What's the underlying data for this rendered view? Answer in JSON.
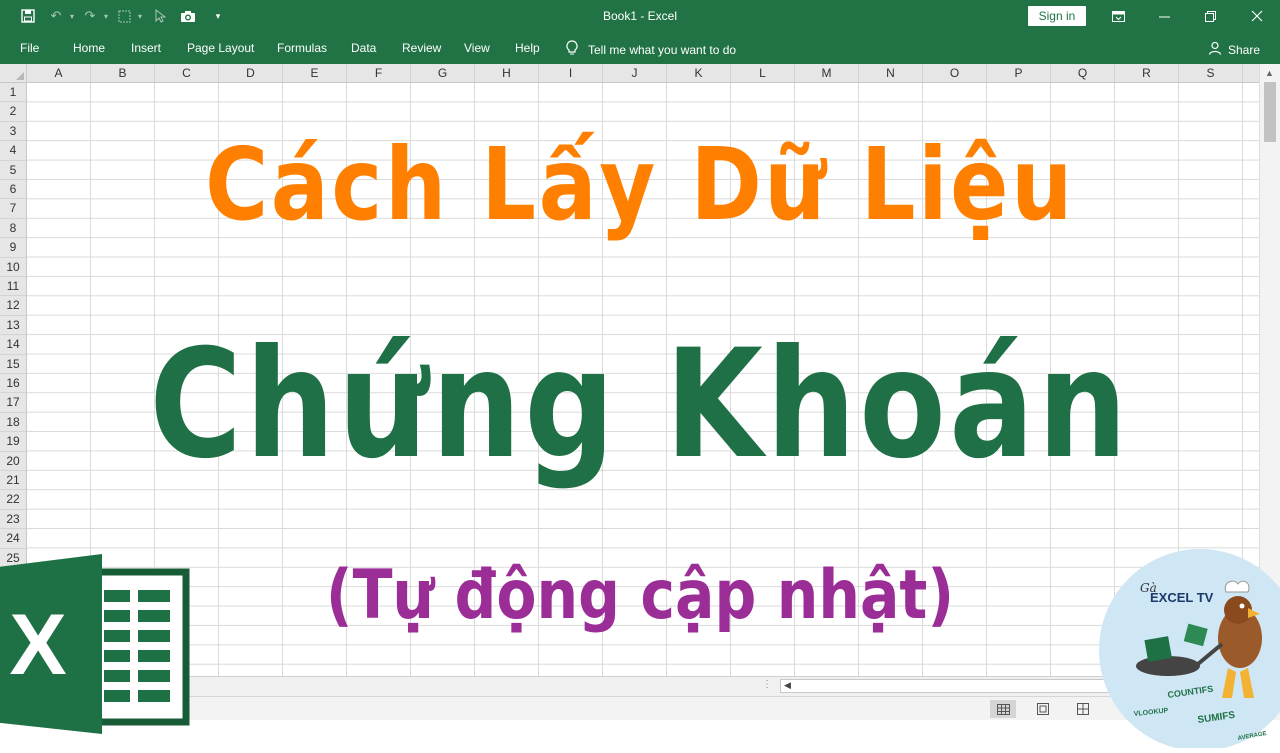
{
  "window": {
    "title": "Book1  -  Excel",
    "sign_in": "Sign in"
  },
  "ribbon": {
    "tabs": [
      "File",
      "Home",
      "Insert",
      "Page Layout",
      "Formulas",
      "Data",
      "Review",
      "View",
      "Help"
    ],
    "tell_me": "Tell me what you want to do",
    "share": "Share"
  },
  "grid": {
    "columns": [
      "A",
      "B",
      "C",
      "D",
      "E",
      "F",
      "G",
      "H",
      "I",
      "J",
      "K",
      "L",
      "M",
      "N",
      "O",
      "P",
      "Q",
      "R",
      "S"
    ],
    "rows": [
      "1",
      "2",
      "3",
      "4",
      "5",
      "6",
      "7",
      "8",
      "9",
      "10",
      "11",
      "12",
      "13",
      "14",
      "15",
      "16",
      "17",
      "18",
      "19",
      "20",
      "21",
      "22",
      "23",
      "24",
      "25"
    ]
  },
  "headline": {
    "line1": "Cách Lấy Dữ Liệu",
    "line2": "Chứng Khoán",
    "line3": "(Tự động cập nhật)"
  },
  "mascot": {
    "brand_small": "Gà",
    "brand": "EXCEL TV",
    "tag1": "SUMIFS",
    "tag2": "COUNTIFS",
    "tag3": "VLOOKUP",
    "tag4": "AVERAGE"
  },
  "logo": {
    "letter": "X"
  },
  "colors": {
    "excel_green": "#217346",
    "orange": "#FF8000",
    "dark_green": "#1F7046",
    "purple": "#9B2D97"
  }
}
